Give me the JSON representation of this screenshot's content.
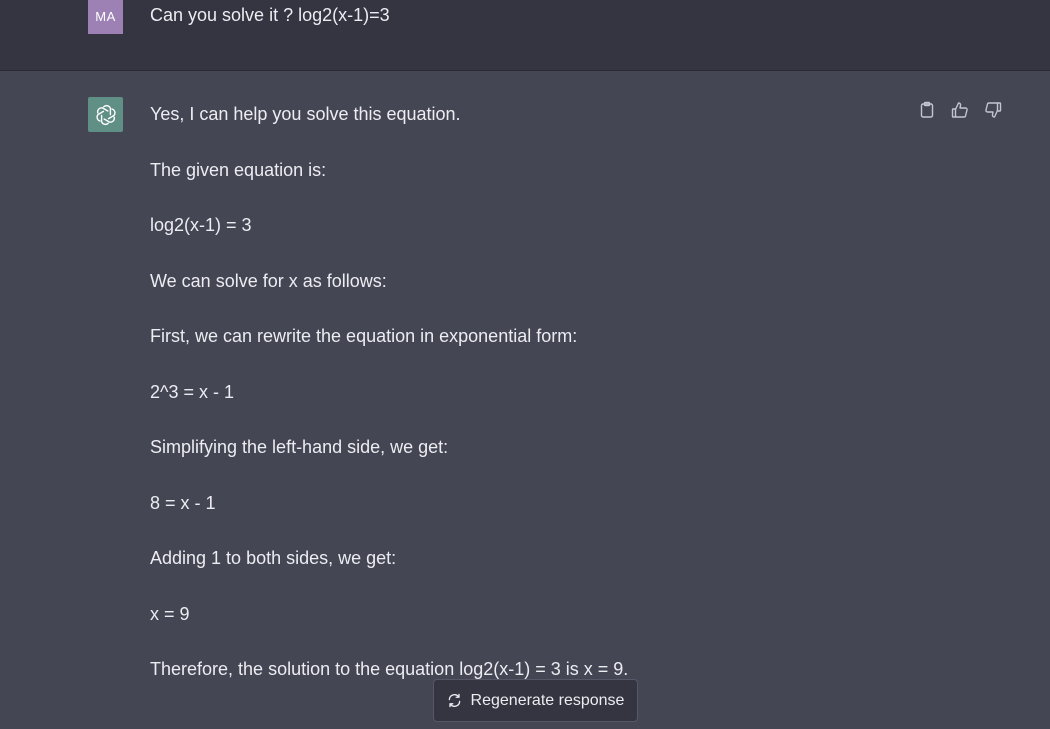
{
  "user_message": {
    "avatar_initials": "MA",
    "text": "Can you solve it ? log2(x-1)=3"
  },
  "assistant_message": {
    "avatar_icon": "openai-logo-icon",
    "paragraphs": [
      "Yes, I can help you solve this equation.",
      "The given equation is:",
      "log2(x-1) = 3",
      "We can solve for x as follows:",
      "First, we can rewrite the equation in exponential form:",
      "2^3 = x - 1",
      "Simplifying the left-hand side, we get:",
      "8 = x - 1",
      "Adding 1 to both sides, we get:",
      "x = 9",
      "Therefore, the solution to the equation log2(x-1) = 3 is x = 9."
    ]
  },
  "actions": {
    "copy_icon": "clipboard-icon",
    "like_icon": "thumbs-up-icon",
    "dislike_icon": "thumbs-down-icon"
  },
  "regenerate": {
    "icon": "refresh-icon",
    "label": "Regenerate response"
  },
  "colors": {
    "user_bg": "#343541",
    "assistant_bg": "#444654",
    "user_avatar": "#9d80b4",
    "bot_avatar": "#5f8f85",
    "text": "#ececf1"
  }
}
